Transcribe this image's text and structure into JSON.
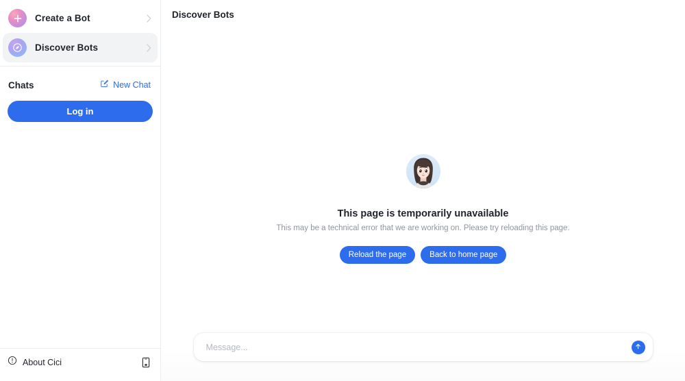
{
  "sidebar": {
    "nav": [
      {
        "label": "Create a Bot",
        "icon": "plus-icon",
        "selected": false
      },
      {
        "label": "Discover Bots",
        "icon": "compass-icon",
        "selected": true
      }
    ],
    "chats": {
      "title": "Chats",
      "new_chat_label": "New Chat",
      "new_chat_icon": "compose-icon"
    },
    "login_label": "Log in",
    "footer": {
      "about_label": "About Cici",
      "about_icon": "info-circle-icon",
      "mobile_icon": "mobile-phone-icon"
    }
  },
  "main": {
    "title": "Discover Bots",
    "error": {
      "avatar_icon": "cici-avatar",
      "title": "This page is temporarily unavailable",
      "subtitle": "This may be a technical error that we are working on. Please try reloading this page.",
      "reload_label": "Reload the page",
      "home_label": "Back to home page"
    },
    "composer": {
      "placeholder": "Message...",
      "value": "",
      "send_icon": "arrow-up-icon"
    }
  },
  "colors": {
    "accent_blue": "#2d6ded",
    "text_primary": "#1f2329",
    "text_muted": "#8f959e",
    "selected_bg": "#f2f3f5",
    "border": "#eceef0"
  }
}
